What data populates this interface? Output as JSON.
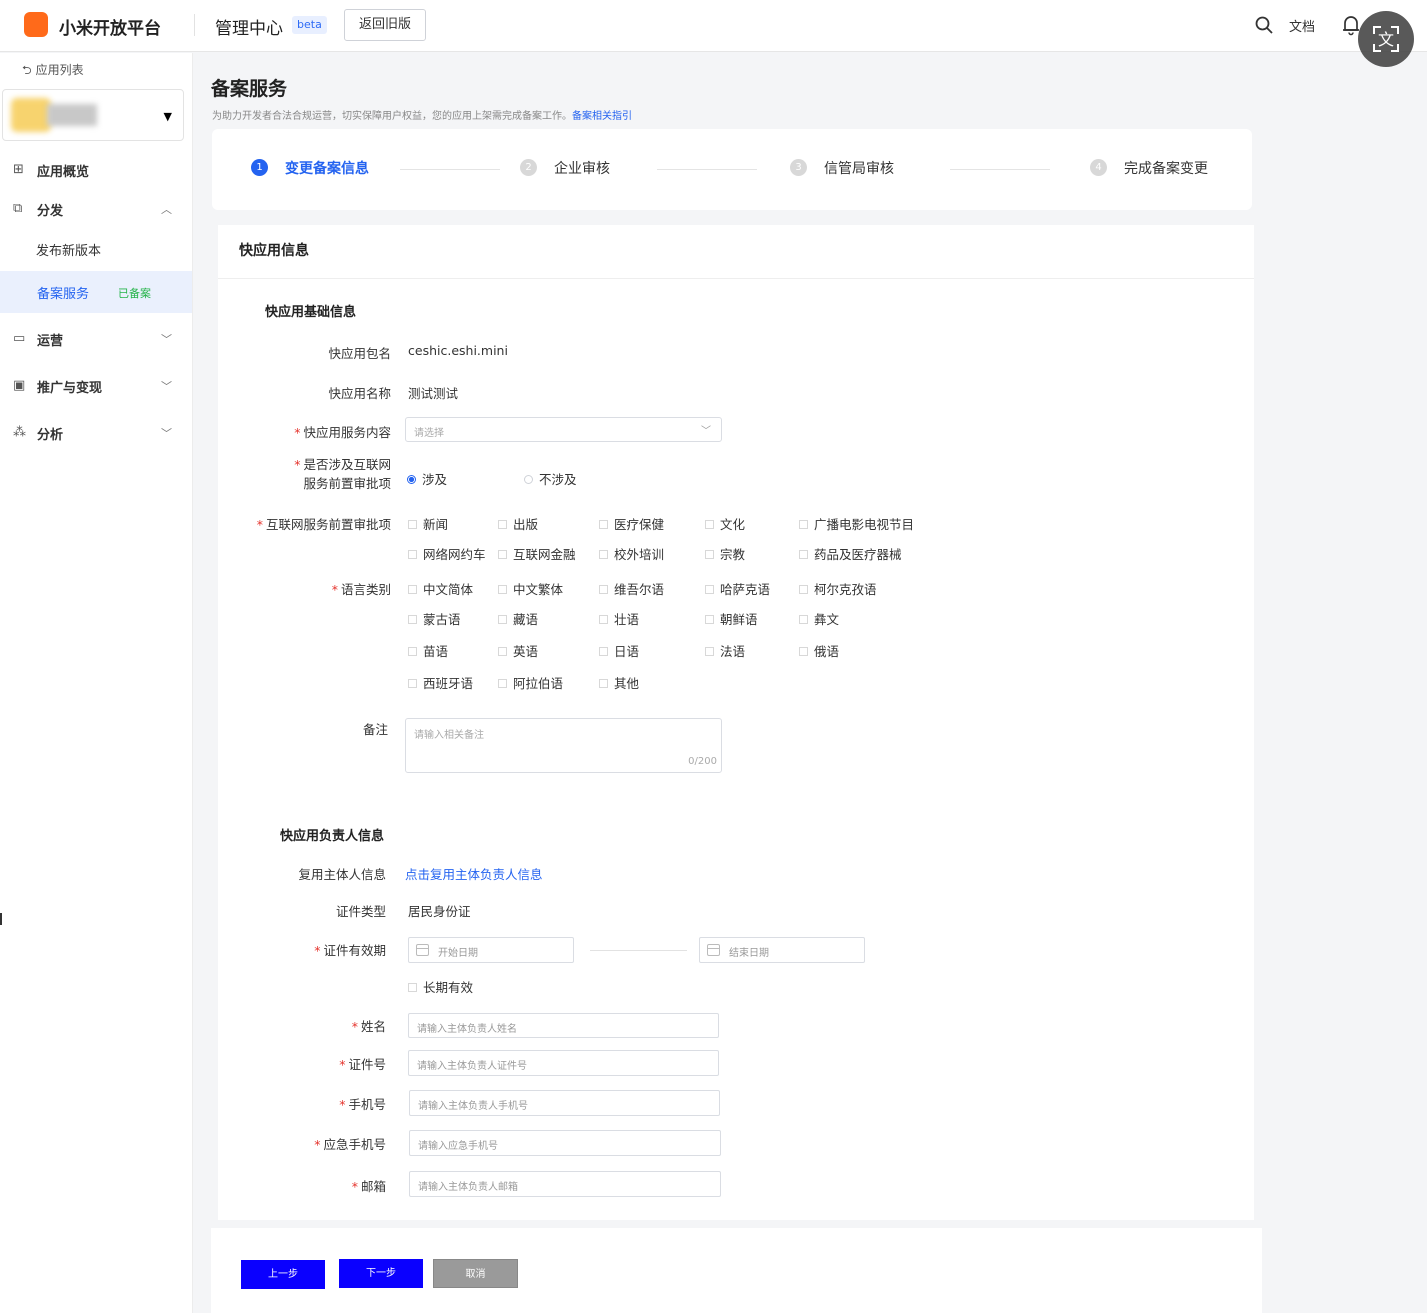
{
  "header": {
    "brand": "小米开放平台",
    "center_title": "管理中心",
    "beta_badge": "beta",
    "old_version_button": "返回旧版",
    "docs_link": "文档"
  },
  "sidebar": {
    "back_label": "应用列表",
    "nav": [
      {
        "label": "应用概览"
      },
      {
        "label": "分发"
      },
      {
        "label": "运营"
      },
      {
        "label": "推广与变现"
      },
      {
        "label": "分析"
      }
    ],
    "sub_items": [
      {
        "label": "发布新版本"
      },
      {
        "label": "备案服务",
        "tag": "已备案"
      }
    ]
  },
  "page": {
    "title": "备案服务",
    "description": "为助力开发者合法合规运营，切实保障用户权益，您的应用上架需完成备案工作。",
    "guide_link": "备案相关指引"
  },
  "steps": [
    {
      "number": "1",
      "label": "变更备案信息",
      "active": true
    },
    {
      "number": "2",
      "label": "企业审核",
      "active": false
    },
    {
      "number": "3",
      "label": "信管局审核",
      "active": false
    },
    {
      "number": "4",
      "label": "完成备案变更",
      "active": false
    }
  ],
  "form": {
    "card_title": "快应用信息",
    "basic_section": "快应用基础信息",
    "package_label": "快应用包名",
    "package_value": "ceshic.eshi.mini",
    "name_label": "快应用名称",
    "name_value": "测试测试",
    "service_content_label": "快应用服务内容",
    "service_content_placeholder": "请选择",
    "involve_label_line1": "是否涉及互联网",
    "involve_label_line2": "服务前置审批项",
    "involve_options": [
      "涉及",
      "不涉及"
    ],
    "involve_selected": "涉及",
    "approval_label": "互联网服务前置审批项",
    "approval_items": [
      "新闻",
      "出版",
      "医疗保健",
      "文化",
      "广播电影电视节目",
      "网络网约车",
      "互联网金融",
      "校外培训",
      "宗教",
      "药品及医疗器械"
    ],
    "language_label": "语言类别",
    "language_items": [
      "中文简体",
      "中文繁体",
      "维吾尔语",
      "哈萨克语",
      "柯尔克孜语",
      "蒙古语",
      "藏语",
      "壮语",
      "朝鲜语",
      "彝文",
      "苗语",
      "英语",
      "日语",
      "法语",
      "俄语",
      "西班牙语",
      "阿拉伯语",
      "其他"
    ],
    "remark_label": "备注",
    "remark_placeholder": "请输入相关备注",
    "remark_counter": "0/200",
    "owner_section": "快应用负责人信息",
    "reuse_label": "复用主体人信息",
    "reuse_link": "点击复用主体负责人信息",
    "id_type_label": "证件类型",
    "id_type_value": "居民身份证",
    "validity_label": "证件有效期",
    "start_date_placeholder": "开始日期",
    "end_date_placeholder": "结束日期",
    "long_term_label": "长期有效",
    "fullname_label": "姓名",
    "fullname_placeholder": "请输入主体负责人姓名",
    "id_number_label": "证件号",
    "id_number_placeholder": "请输入主体负责人证件号",
    "phone_label": "手机号",
    "phone_placeholder": "请输入主体负责人手机号",
    "emergency_label": "应急手机号",
    "emergency_placeholder": "请输入应急手机号",
    "email_label": "邮箱",
    "email_placeholder": "请输入主体负责人邮箱"
  },
  "buttons": {
    "prev": "上一步",
    "next": "下一步",
    "cancel": "取消"
  },
  "colors": {
    "accent": "#2463f0",
    "brand": "#ff6a1a",
    "primary_button": "#0a00ff",
    "required": "#e5332c",
    "registered_tag": "#26b44a"
  },
  "icons": [
    "search-icon",
    "bell-icon",
    "translate-icon",
    "back-arrow-icon",
    "grid-icon",
    "share-icon",
    "monitor-icon",
    "promotion-icon",
    "analysis-icon",
    "calendar-icon",
    "chevron-down-icon"
  ]
}
